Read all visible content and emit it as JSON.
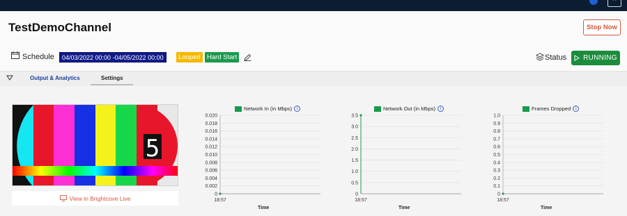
{
  "channel": {
    "title": "TestDemoChannel",
    "stop_label": "Stop Now"
  },
  "schedule": {
    "label": "Schedule",
    "range": "04/03/2022 00:00 -04/05/2022 00:00",
    "looped": "Looped",
    "hard_start": "Hard Start"
  },
  "status": {
    "label": "Status",
    "running": "RUNNING"
  },
  "tabs": [
    {
      "label": "Output & Analytics"
    },
    {
      "label": "Settings"
    }
  ],
  "preview": {
    "view_link": "View in Brightcove Live",
    "overlay_digit": "5"
  },
  "colors": {
    "accent_orange": "#d6563b",
    "running_green": "#1d8c3d",
    "badge_yellow": "#f5b800",
    "date_navy": "#101a8a",
    "series_green": "#1a9a4d"
  },
  "chart_data": [
    {
      "type": "line",
      "title": "",
      "series": [
        {
          "name": "Network In (in Mbps)",
          "values": [
            0
          ]
        }
      ],
      "x": [
        "18:57"
      ],
      "xlabel": "Time",
      "ylabel": "",
      "ylim": [
        0,
        0.02
      ],
      "yticks": [
        "0.020",
        "0.018",
        "0.016",
        "0.014",
        "0.012",
        "0.010",
        "0.008",
        "0.006",
        "0.004",
        "0.002",
        "0"
      ],
      "grid": true
    },
    {
      "type": "line",
      "title": "",
      "series": [
        {
          "name": "Network Out (in Mbps)",
          "values": [
            3.5
          ]
        }
      ],
      "x": [
        "18:57"
      ],
      "xlabel": "Time",
      "ylabel": "",
      "ylim": [
        0,
        3.5
      ],
      "yticks": [
        "3.5",
        "3.0",
        "2.5",
        "2.0",
        "1.5",
        "1.0",
        "0.5",
        "0"
      ],
      "grid": true
    },
    {
      "type": "line",
      "title": "",
      "series": [
        {
          "name": "Frames Dropped",
          "values": [
            0
          ]
        }
      ],
      "x": [
        "18:57"
      ],
      "xlabel": "Time",
      "ylabel": "",
      "ylim": [
        0,
        1
      ],
      "yticks": [
        "1.0",
        "0.9",
        "0.8",
        "0.7",
        "0.6",
        "0.5",
        "0.4",
        "0.3",
        "0.2",
        "0.1",
        "0"
      ],
      "grid": true
    }
  ]
}
